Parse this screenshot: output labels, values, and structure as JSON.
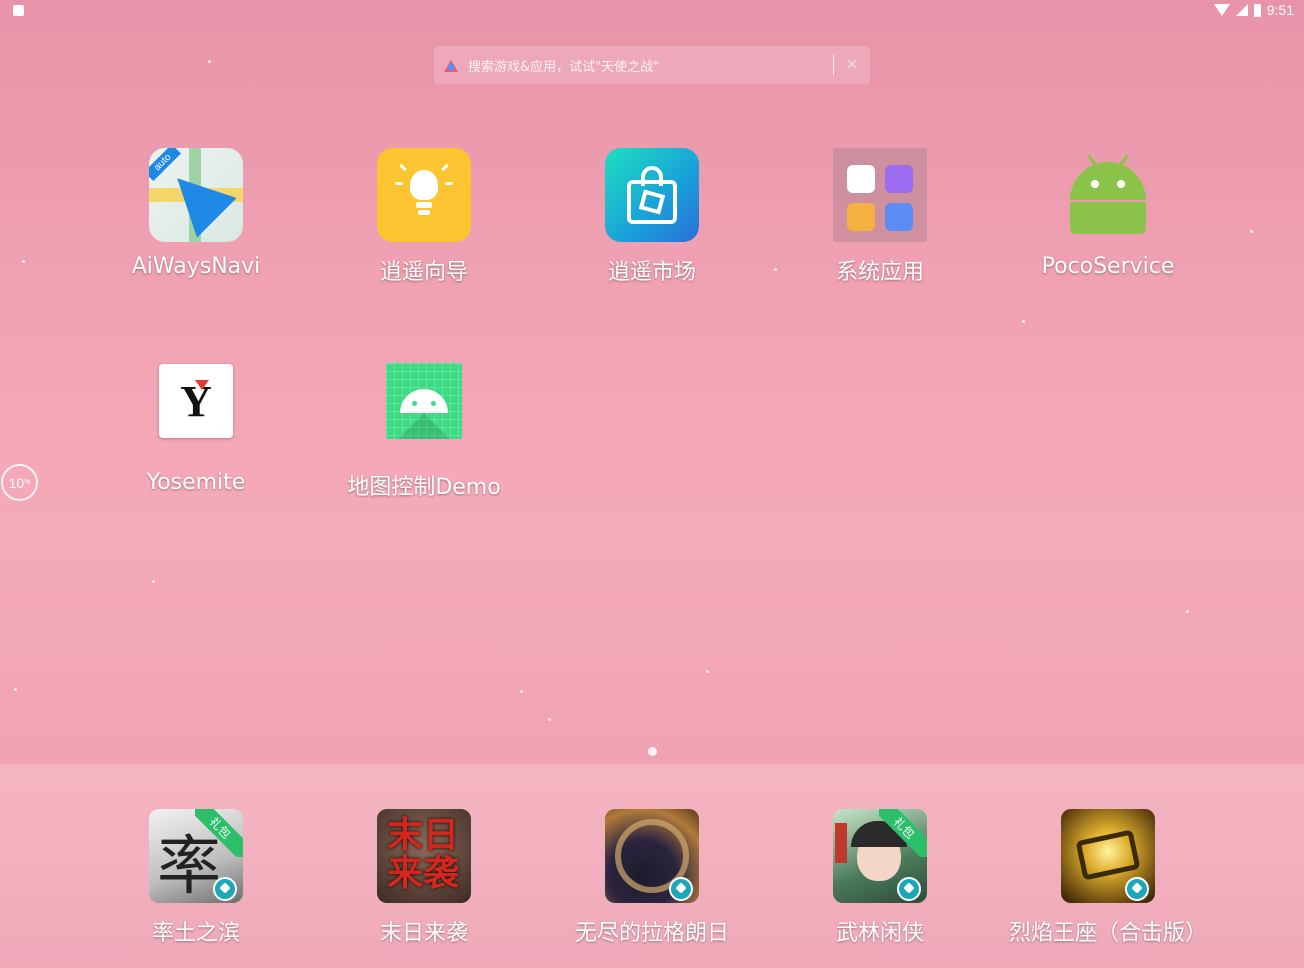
{
  "status_bar": {
    "time": "9:51"
  },
  "search": {
    "placeholder": "搜索游戏&应用，试试\"天使之战\""
  },
  "apps": [
    {
      "label": "AiWaysNavi",
      "icon": "paper-plane-navigation-icon",
      "badge": "auto"
    },
    {
      "label": "逍遥向导",
      "icon": "lightbulb-icon"
    },
    {
      "label": "逍遥市场",
      "icon": "shopping-bag-icon"
    },
    {
      "label": "系统应用",
      "icon": "folder-icon"
    },
    {
      "label": "PocoService",
      "icon": "android-robot-icon"
    },
    {
      "label": "Yosemite",
      "icon": "yosemite-logo-icon"
    },
    {
      "label": "地图控制Demo",
      "icon": "android-robot-grid-icon"
    }
  ],
  "side_indicator": {
    "value": "10",
    "unit": "%"
  },
  "dock": [
    {
      "label": "率土之滨",
      "icon": "game-icon-1",
      "ribbon": "礼包"
    },
    {
      "label": "末日来袭",
      "icon": "game-icon-2"
    },
    {
      "label": "无尽的拉格朗日",
      "icon": "game-icon-3"
    },
    {
      "label": "武林闲侠",
      "icon": "game-icon-4",
      "ribbon": "礼包"
    },
    {
      "label": "烈焰王座（合击版）",
      "icon": "game-icon-5"
    }
  ],
  "colors": {
    "accent_green": "#3ddc84",
    "android_green": "#8bc34a",
    "market_teal": "#1ddfc0",
    "guide_yellow": "#fbc531"
  }
}
